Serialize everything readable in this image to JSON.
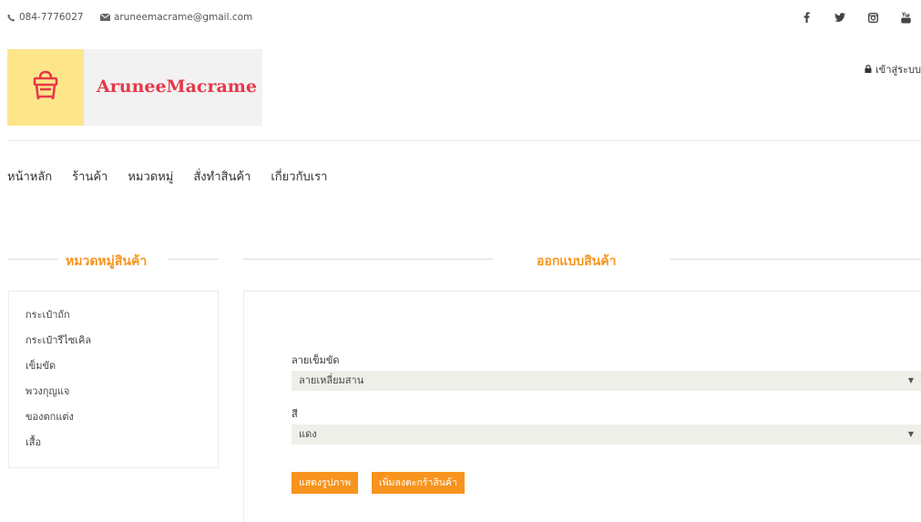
{
  "topbar": {
    "phone": "084-7776027",
    "email": "aruneemacrame@gmail.com",
    "social_icons": [
      "facebook-icon",
      "twitter-icon",
      "instagram-icon",
      "youtube-icon"
    ]
  },
  "logo": {
    "text": "AruneeMacrame",
    "icon": "shopping-bag-icon"
  },
  "login": {
    "label": "เข้าสู่ระบบ"
  },
  "nav": {
    "items": [
      "หน้าหลัก",
      "ร้านค้า",
      "หมวดหมู่",
      "สั่งทำสินค้า",
      "เกี่ยวกับเรา"
    ]
  },
  "sidebar": {
    "title": "หมวดหมู่สินค้า",
    "categories": [
      "กระเป๋าถัก",
      "กระเป๋ารีไซเคิล",
      "เข็มขัด",
      "พวงกุญแจ",
      "ของตกแต่ง",
      "เสื้อ"
    ]
  },
  "design": {
    "title": "ออกแบบสินค้า",
    "pattern_label": "ลายเข็มขัด",
    "pattern_value": "ลายเหลี่ยมสาน",
    "color_label": "สี",
    "color_value": "แดง",
    "show_image_button": "แสดงรูปภาพ",
    "add_to_cart_button": "เพิ่มลงตะกร้าสินค้า"
  },
  "colors": {
    "accent": "#f7941d",
    "brand_text": "#e53949",
    "logo_bg": "#fde68a"
  }
}
